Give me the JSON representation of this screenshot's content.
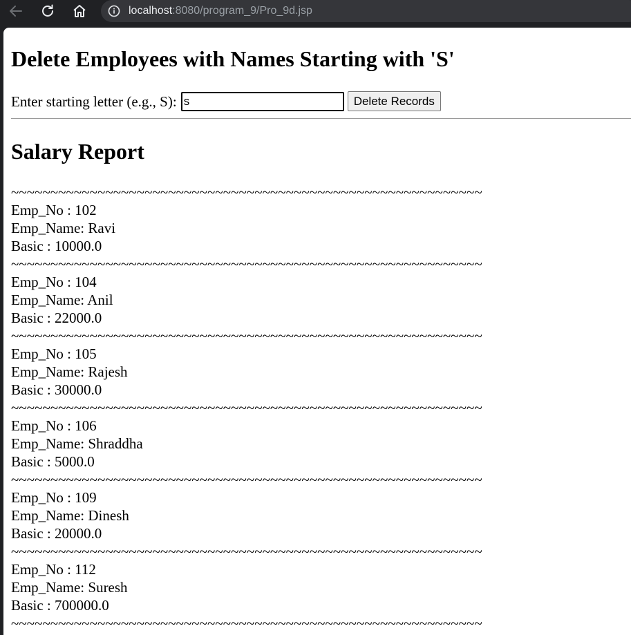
{
  "browser": {
    "url_host": "localhost",
    "url_path": ":8080/program_9/Pro_9d.jsp"
  },
  "page": {
    "title": "Delete Employees with Names Starting with 'S'",
    "form": {
      "label": "Enter starting letter (e.g., S):",
      "input_value": "s",
      "button_label": "Delete Records"
    },
    "report_title": "Salary Report",
    "separator": "~~~~~~~~~~~~~~~~~~~~~~~~~~~~~~~~~~~~~~~~~~~~~~~~~~~~~~~~~~~~",
    "employees": [
      {
        "no": "Emp_No : 102",
        "name": "Emp_Name: Ravi",
        "basic": "Basic : 10000.0"
      },
      {
        "no": "Emp_No : 104",
        "name": "Emp_Name: Anil",
        "basic": "Basic : 22000.0"
      },
      {
        "no": "Emp_No : 105",
        "name": "Emp_Name: Rajesh",
        "basic": "Basic : 30000.0"
      },
      {
        "no": "Emp_No : 106",
        "name": "Emp_Name: Shraddha",
        "basic": "Basic : 5000.0"
      },
      {
        "no": "Emp_No : 109",
        "name": "Emp_Name: Dinesh",
        "basic": "Basic : 20000.0"
      },
      {
        "no": "Emp_No : 112",
        "name": "Emp_Name: Suresh",
        "basic": "Basic : 700000.0"
      }
    ]
  }
}
